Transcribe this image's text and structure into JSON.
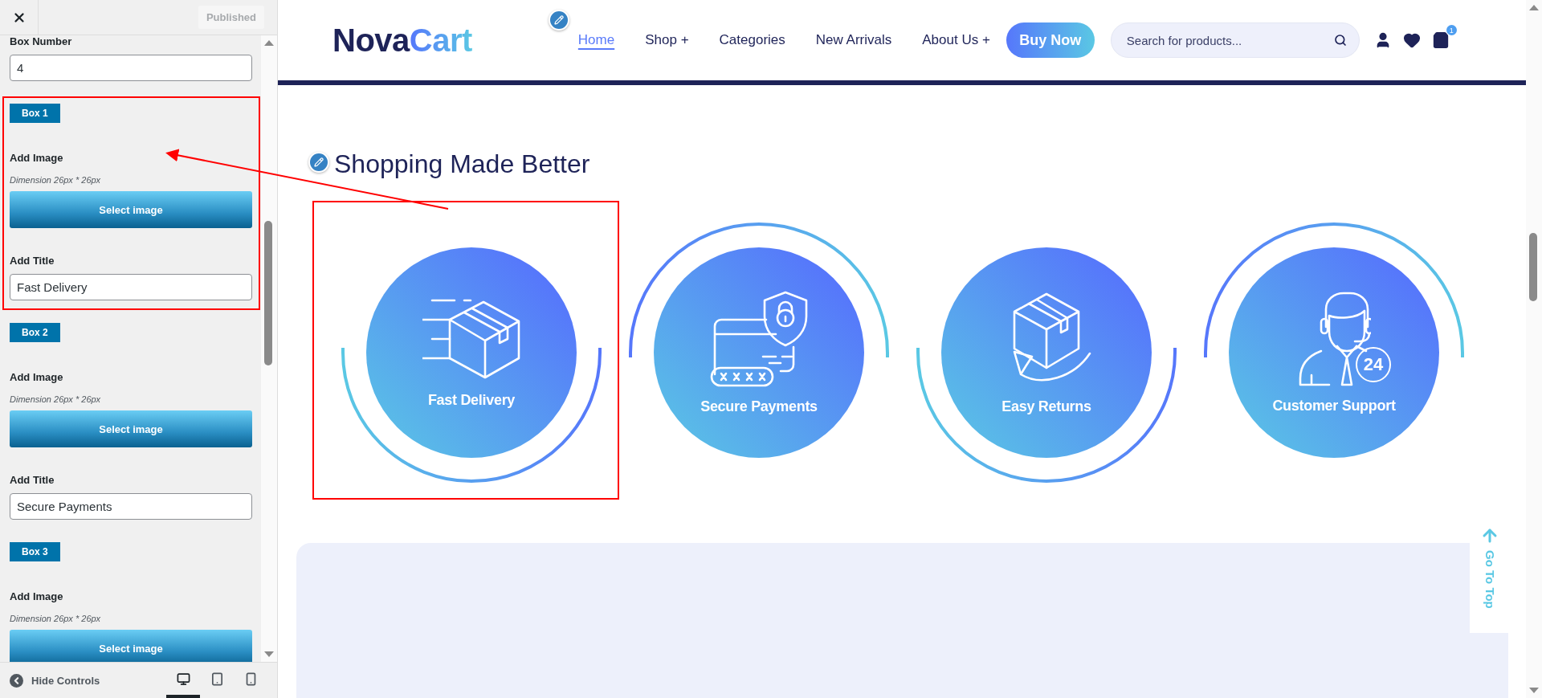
{
  "customizer": {
    "publish_button": "Published",
    "box_number": {
      "label": "Box Number",
      "value": "4"
    },
    "boxes": [
      {
        "tag": "Box 1",
        "image_label": "Add Image",
        "dimension": "Dimension 26px * 26px",
        "button": "Select image",
        "title_label": "Add Title",
        "title_value": "Fast Delivery"
      },
      {
        "tag": "Box 2",
        "image_label": "Add Image",
        "dimension": "Dimension 26px * 26px",
        "button": "Select image",
        "title_label": "Add Title",
        "title_value": "Secure Payments"
      },
      {
        "tag": "Box 3",
        "image_label": "Add Image",
        "dimension": "Dimension 26px * 26px",
        "button": "Select image"
      }
    ],
    "hide_controls": "Hide Controls",
    "devices": [
      {
        "kind": "desktop",
        "selected": true
      },
      {
        "kind": "tablet",
        "selected": false
      },
      {
        "kind": "mobile",
        "selected": false
      }
    ]
  },
  "site": {
    "logo": {
      "dark": "Nova",
      "light": "Cart"
    },
    "nav": [
      {
        "label": "Home",
        "selected": true
      },
      {
        "label": "Shop +",
        "selected": false
      },
      {
        "label": "Categories",
        "selected": false
      },
      {
        "label": "New Arrivals",
        "selected": false
      },
      {
        "label": "About Us +",
        "selected": false
      }
    ],
    "cta": "Buy Now",
    "search": {
      "placeholder": "Search for products..."
    },
    "cart_count": "1",
    "section_title": "Shopping Made Better",
    "features": [
      {
        "title": "Fast Delivery",
        "kind": "bottom-arc"
      },
      {
        "title": "Secure Payments",
        "kind": "top-arc"
      },
      {
        "title": "Easy Returns",
        "kind": "bottom-arc"
      },
      {
        "title": "Customer Support",
        "kind": "top-arc",
        "badge": "24"
      }
    ],
    "go_to_top": "Go To Top"
  }
}
